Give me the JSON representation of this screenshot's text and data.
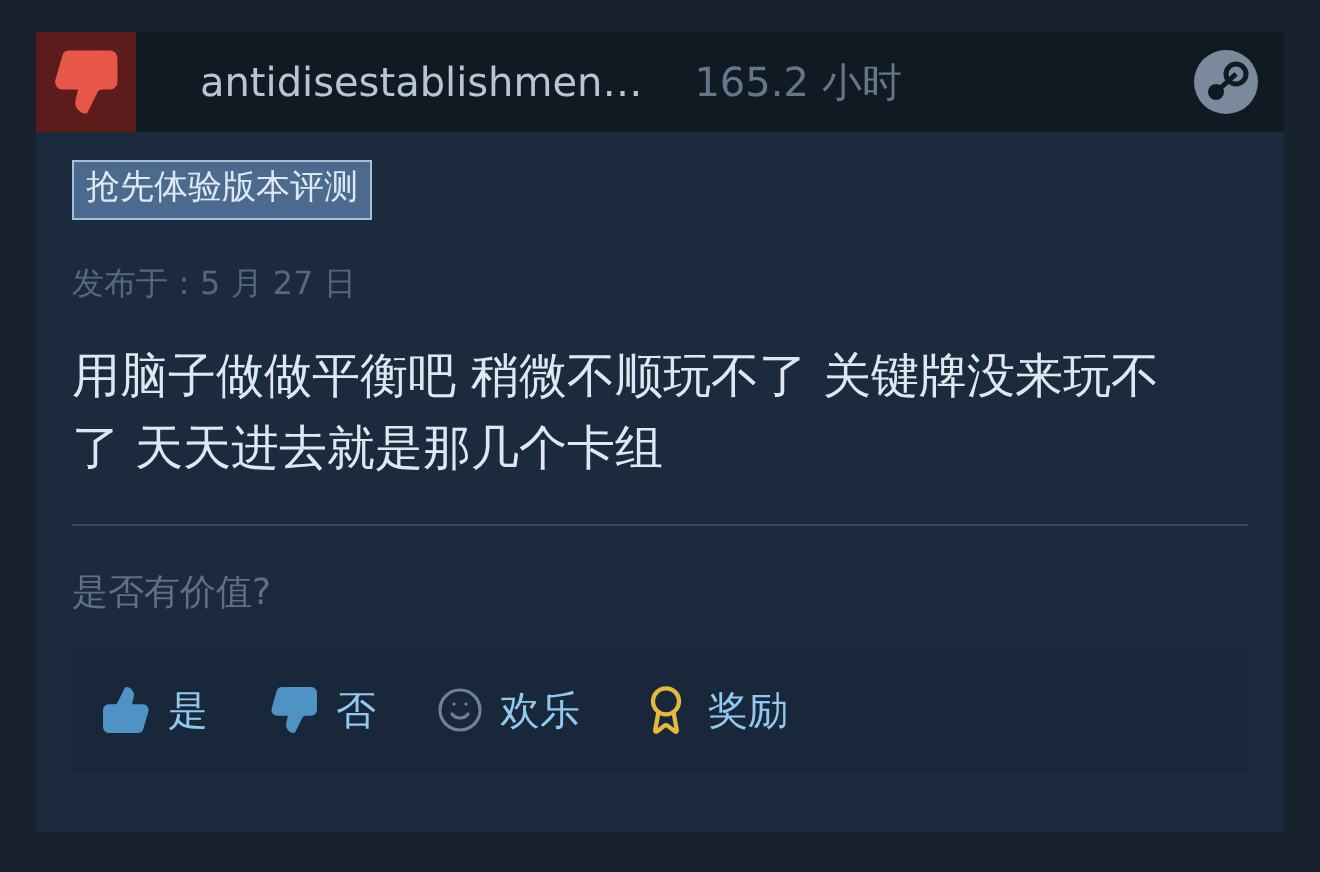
{
  "review": {
    "recommended": false,
    "author": "antidisestablishmen…",
    "hours": "165.2 小时",
    "badge": "抢先体验版本评测",
    "posted": "发布于：5 月 27 日",
    "text": "用脑子做做平衡吧 稍微不顺玩不了 关键牌没来玩不了 天天进去就是那几个卡组"
  },
  "helpful": {
    "prompt": "是否有价值?",
    "buttons": [
      {
        "kind": "yes",
        "label": "是"
      },
      {
        "kind": "no",
        "label": "否"
      },
      {
        "kind": "funny",
        "label": "欢乐"
      },
      {
        "kind": "award",
        "label": "奖励"
      }
    ]
  }
}
